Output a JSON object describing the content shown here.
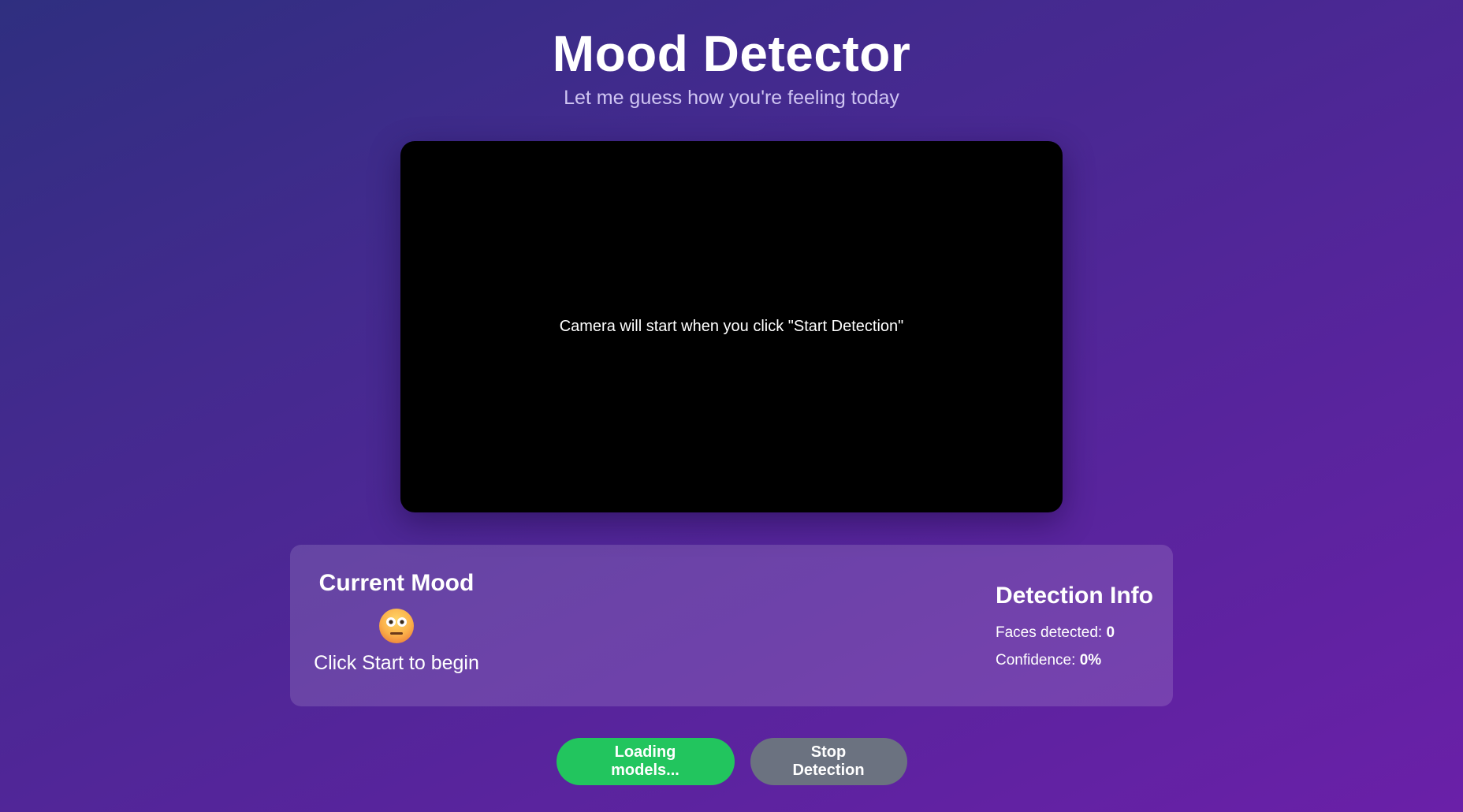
{
  "header": {
    "title": "Mood Detector",
    "subtitle": "Let me guess how you're feeling today"
  },
  "video": {
    "placeholder": "Camera will start when you click \"Start Detection\""
  },
  "mood": {
    "heading": "Current Mood",
    "emoji_icon": "neutral-face-icon",
    "status": "Click Start to begin"
  },
  "info": {
    "heading": "Detection Info",
    "faces_label": "Faces detected: ",
    "faces_value": "0",
    "confidence_label": "Confidence: ",
    "confidence_value": "0%"
  },
  "buttons": {
    "start_label": "Loading models...",
    "stop_label": "Stop Detection"
  },
  "colors": {
    "start_button": "#22c55e",
    "stop_button": "#6b7280"
  }
}
